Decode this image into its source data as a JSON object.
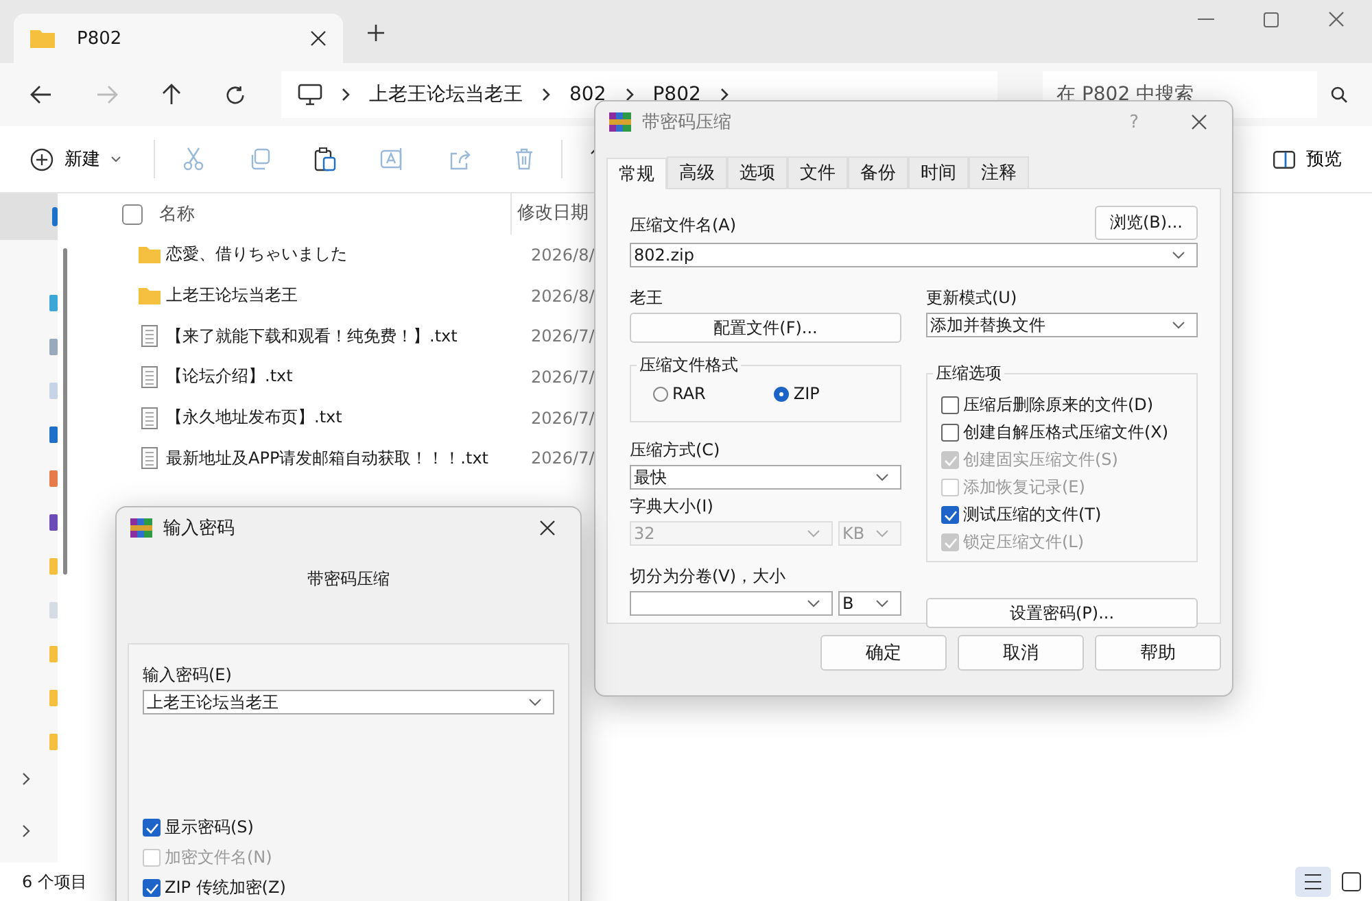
{
  "explorer": {
    "tab_title": "P802",
    "address": [
      "上老王论坛当老王",
      "802",
      "P802"
    ],
    "search": {
      "placeholder": "在 P802 中搜索"
    },
    "new_label": "新建",
    "preview_label": "预览",
    "columns": [
      "名称",
      "修改日期"
    ],
    "select_all": {
      "checked": false
    },
    "files": [
      {
        "kind": "folder",
        "name": "恋愛、借りちゃいました",
        "date": "2026/8/"
      },
      {
        "kind": "folder",
        "name": "上老王论坛当老王",
        "date": "2026/8/"
      },
      {
        "kind": "file",
        "name": "【来了就能下载和观看！纯免费！】.txt",
        "date": "2026/7/"
      },
      {
        "kind": "file",
        "name": "【论坛介绍】.txt",
        "date": "2026/7/"
      },
      {
        "kind": "file",
        "name": "【永久地址发布页】.txt",
        "date": "2026/7/"
      },
      {
        "kind": "file",
        "name": "最新地址及APP请发邮箱自动获取！！！.txt",
        "date": "2026/7/"
      }
    ],
    "status": "6 个项目"
  },
  "archive_dialog": {
    "title": "带密码压缩",
    "help": "?",
    "tabs": [
      {
        "label": "常规",
        "selected": true
      },
      {
        "label": "高级",
        "selected": false
      },
      {
        "label": "选项",
        "selected": false
      },
      {
        "label": "文件",
        "selected": false
      },
      {
        "label": "备份",
        "selected": false
      },
      {
        "label": "时间",
        "selected": false
      },
      {
        "label": "注释",
        "selected": false
      }
    ],
    "archive_name_label": "压缩文件名(A)",
    "archive_name": "802.zip",
    "browse_button": "浏览(B)...",
    "profile_label": "老王",
    "profile_button": "配置文件(F)...",
    "update_mode_label": "更新模式(U)",
    "update_mode": "添加并替换文件",
    "format_label": "压缩文件格式",
    "formats": [
      {
        "label": "RAR",
        "selected": false
      },
      {
        "label": "ZIP",
        "selected": true
      }
    ],
    "method_label": "压缩方式(C)",
    "method": "最快",
    "dict_label": "字典大小(I)",
    "dict_size": "32",
    "dict_unit": "KB",
    "dict_disabled": true,
    "split_label": "切分为分卷(V)，大小",
    "split_unit": "B",
    "options_label": "压缩选项",
    "options": [
      {
        "label": "压缩后删除原来的文件(D)",
        "checked": false,
        "disabled": false
      },
      {
        "label": "创建自解压格式压缩文件(X)",
        "checked": false,
        "disabled": false
      },
      {
        "label": "创建固实压缩文件(S)",
        "checked": true,
        "disabled": true
      },
      {
        "label": "添加恢复记录(E)",
        "checked": false,
        "disabled": true
      },
      {
        "label": "测试压缩的文件(T)",
        "checked": true,
        "disabled": false
      },
      {
        "label": "锁定压缩文件(L)",
        "checked": true,
        "disabled": true
      }
    ],
    "password_button": "设置密码(P)...",
    "buttons": [
      "确定",
      "取消",
      "帮助"
    ]
  },
  "password_dialog": {
    "title": "输入密码",
    "heading": "带密码压缩",
    "field_label": "输入密码(E)",
    "value": "上老王论坛当老王",
    "options": [
      {
        "label": "显示密码(S)",
        "checked": true,
        "disabled": false
      },
      {
        "label": "加密文件名(N)",
        "checked": false,
        "disabled": true
      },
      {
        "label": "ZIP 传统加密(Z)",
        "checked": true,
        "disabled": false
      }
    ]
  }
}
